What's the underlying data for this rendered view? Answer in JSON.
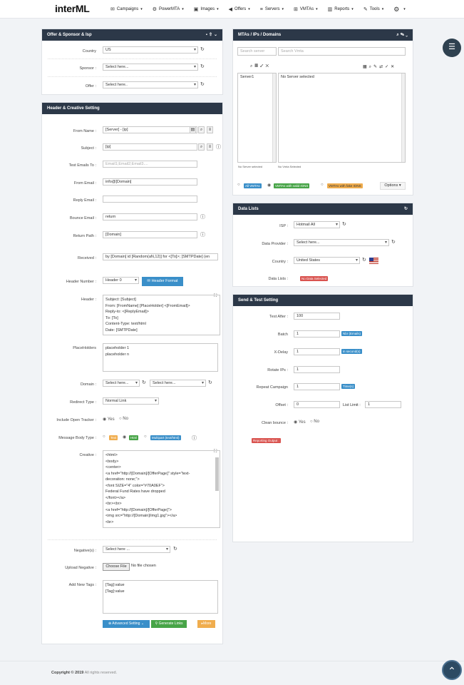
{
  "brand": {
    "logo": "interML"
  },
  "nav": {
    "items": [
      {
        "label": "Campaigns",
        "icon": "envelope-icon"
      },
      {
        "label": "PowerMTA",
        "icon": "gears-icon"
      },
      {
        "label": "Images",
        "icon": "image-icon"
      },
      {
        "label": "Offers",
        "icon": "bullhorn-icon"
      },
      {
        "label": "Servers",
        "icon": "server-icon"
      },
      {
        "label": "VMTAs",
        "icon": "sitemap-icon"
      },
      {
        "label": "Reports",
        "icon": "chart-icon"
      },
      {
        "label": "Tools",
        "icon": "wrench-icon"
      }
    ]
  },
  "offer_panel": {
    "title": "Offer & Sponsor & Isp",
    "country_label": "Country",
    "country_value": "US",
    "sponsor_label": "Sponsor :",
    "sponsor_value": "Select here...",
    "offer_label": "Offer :",
    "offer_value": "Select here.."
  },
  "header_panel": {
    "title": "Header & Creative Setting",
    "from_name_label": "From Name :",
    "from_name_value": "[Server] - [ip]",
    "subject_label": "Subject :",
    "subject_value": "[ip]",
    "test_emails_label": "Test Emails To :",
    "test_emails_placeholder": "Email1;Email2;Email3....",
    "from_email_label": "From Email :",
    "from_email_value": "info@[Domain]",
    "reply_email_label": "Reply Email :",
    "bounce_email_label": "Bounce Email :",
    "bounce_email_value": "return",
    "return_path_label": "Return Path :",
    "return_path_value": "[Domain]",
    "received_label": "Received :",
    "received_value": "by [Domain] id [Random(aN,12)] for <[To]>; [SMTPDate] (en",
    "header_number_label": "Header Number :",
    "header_number_value": "Header 0",
    "header_format_button": "Header Format",
    "header_label": "Header :",
    "header_value": "Subject: [Subject]\nFrom: [FromName] [PlaceHolder] <[FromEmail]>\nReply-to: <[ReplyEmail]>\nTo: [To]\nContent-Type: text/html\nDate: [SMTPDate]",
    "placeholders_label": "PlaceHolders",
    "placeholders_placeholder": "placeholder 1\nplaceholder n",
    "domain_label": "Domain :",
    "domain_value1": "Select here...",
    "domain_value2": "Select here...",
    "redirect_label": "Redirect Type :",
    "redirect_value": "Normal Link",
    "open_tracker_label": "Include Open Tracker :",
    "yes": "Yes",
    "no": "No",
    "body_type_label": "Message Body Type :",
    "body_text": "Text",
    "body_html": "Html",
    "body_multipart": "Multipart (text/html)",
    "creative_label": "Creative :",
    "creative_value": "<html>\n<body>\n<center>\n<a href=\"http://[Domain]/[OfferPage]\" style=\"text-\ndecoration: none;\">\n<font SIZE=\"4\" color=\"#70A0EF\">\nFederal Fund Rates have dropped\n</font></a>\n<br><br>\n<a href=\"http://[Domain]/[OfferPage]\">\n<img src=\"http://[Domain]/img1.jpg\"></a>\n<br>",
    "negatives_label": "Negative(s) :",
    "negatives_value": "Select here ...",
    "upload_label": "Upload Negative :",
    "choose_file": "Choose File",
    "no_file": "No file chosen",
    "new_tags_label": "Add New Tags :",
    "new_tags_placeholder": "[Tag]:value\n[Tag]:value",
    "advanced_button": "Advanced Setting",
    "generate_button": "Generate Links",
    "more_button": "More"
  },
  "mta_panel": {
    "title": "MTAs / IPs / Domains",
    "search_server_placeholder": "Search server",
    "search_vmta_placeholder": "Search Vmta",
    "servers": [
      "Server1"
    ],
    "no_server": "No Server selected",
    "servers_count": "No Server selected",
    "vmtas_count": "No Vmta Selected",
    "all_vmtas": "All VMTAs",
    "valid_rdns": "VMTAs with valid rDNS",
    "fake_rdns": "VMTAs with fake rDNS",
    "options": "Options"
  },
  "data_panel": {
    "title": "Data Lists",
    "isp_label": "ISP :",
    "isp_value": "Hotmail All",
    "provider_label": "Data Provider :",
    "provider_value": "Select here...",
    "country_label": "Country :",
    "country_value": "United States",
    "lists_label": "Data Lists :",
    "no_data": "No Data Selected"
  },
  "send_panel": {
    "title": "Send & Test Setting",
    "test_after_label": "Test After :",
    "test_after_value": "100",
    "batch_label": "Batch",
    "batch_value": "1",
    "batch_unit": "Nbr (Emails)",
    "xdelay_label": "X-Delay",
    "xdelay_value": "1",
    "xdelay_unit": "in second(s)",
    "rotate_label": "Rotate IPs :",
    "rotate_value": "1",
    "repeat_label": "Repeat Campaign",
    "repeat_value": "1",
    "repeat_unit": "Time(s)",
    "offset_label": "Offset :",
    "offset_value": "0",
    "list_limit_label": "List Limit :",
    "list_limit_value": "1",
    "clean_bounce_label": "Clean bounce :",
    "reporting_output": "Reporting Output :"
  },
  "footer": {
    "copyright": "Copyright © 2019",
    "rights": "All rights reserved."
  },
  "colors": {
    "panel_header": "#2c3848",
    "blue": "#3a8fc9",
    "green": "#47a447",
    "orange": "#f0ad4e",
    "red": "#d9534f"
  }
}
